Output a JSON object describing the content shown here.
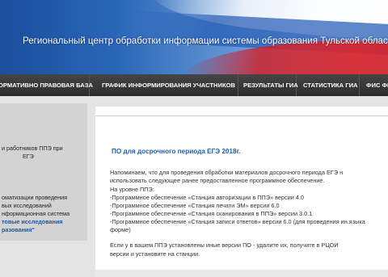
{
  "header": {
    "title": "Региональный центр обработки информации системы образования Тульской области"
  },
  "nav": {
    "items": [
      "ОРМАТИВНО ПРАВОВАЯ БАЗА",
      "ГРАФИК ИНФОРМИРОВАНИЯ УЧАСТНИКОВ",
      "РЕЗУЛЬТАТЫ ГИА",
      "СТАТИСТИКА ГИА",
      "ФИС ФР"
    ]
  },
  "sidebar": {
    "block1": [
      "и работников ППЭ при",
      "ЕГЭ"
    ],
    "block2": [
      "оматизации проведения",
      "вых исследований",
      "нформационная система"
    ],
    "link": [
      "товые исследования",
      "разования\""
    ]
  },
  "article": {
    "title": "ПО для досрочного периода ЕГЭ 2018г.",
    "paragraph1": [
      "Напоминаем, что для проведения обработки материалов досрочного периода ЕГЭ н",
      "использовать следующее ранее предоставленное программное обеспечение."
    ],
    "ppe_heading": "На уровне ППЭ:",
    "software": [
      "-Программное обеспечение «Станция авторизации в ППЭ» версии 4.0",
      "-Программное обеспечение «Станция печати ЭМ» версии 6.0",
      "-Программное обеспечение «Станция сканирования в ППЭ» версии 3.0.1",
      "-Программное обеспечение «Станция записи ответов» версии 6.0 (для проведения ин.языка",
      "форме)"
    ],
    "paragraph2": [
      "Если у в вашем ППЭ установлены иные версии ПО - удалите их, получите в РЦОИ",
      "версии и установите на станции."
    ]
  }
}
